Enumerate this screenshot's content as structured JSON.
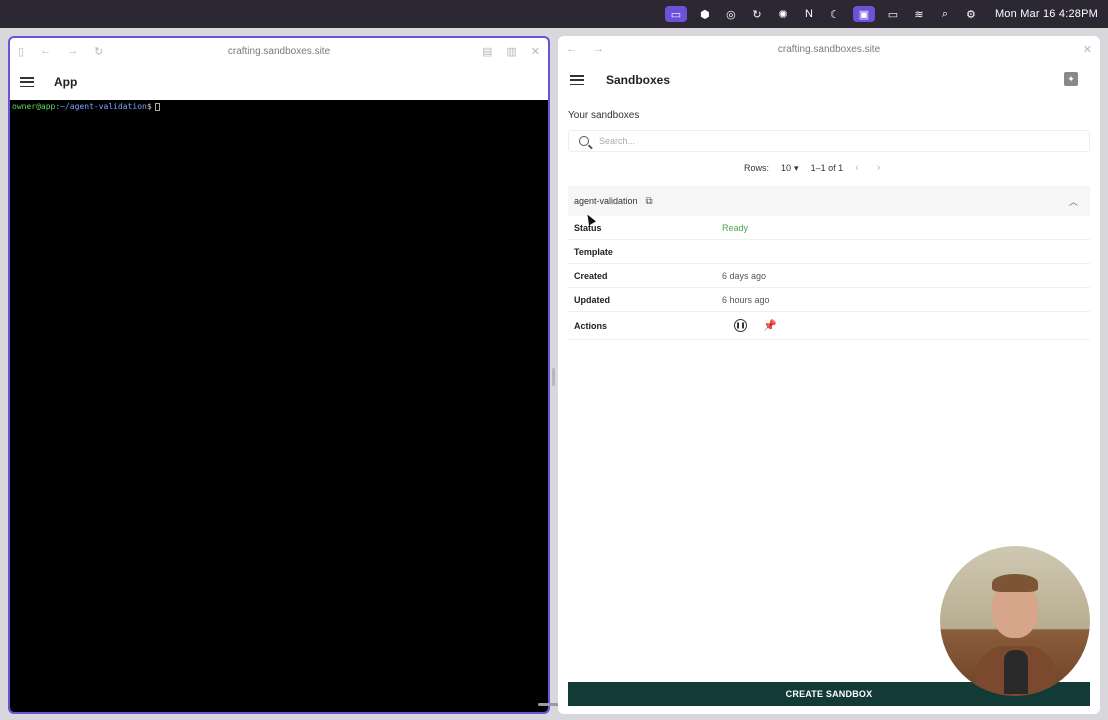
{
  "menubar": {
    "clock": "Mon Mar 16  4:28PM"
  },
  "left_window": {
    "url": "crafting.sandboxes.site",
    "app_title": "App",
    "terminal": {
      "user_host": "owner@app",
      "path": ":~/agent-validation",
      "prompt_symbol": "$"
    }
  },
  "right_window": {
    "url": "crafting.sandboxes.site",
    "app_title": "Sandboxes",
    "section_title": "Your sandboxes",
    "search_placeholder": "Search...",
    "pager": {
      "rows_label": "Rows:",
      "rows_value": "10",
      "range": "1–1 of 1"
    },
    "sandbox": {
      "name": "agent-validation",
      "fields": [
        {
          "label": "Status",
          "value": "Ready"
        },
        {
          "label": "Template",
          "value": ""
        },
        {
          "label": "Created",
          "value": "6 days ago"
        },
        {
          "label": "Updated",
          "value": "6 hours ago"
        }
      ],
      "actions_label": "Actions"
    },
    "create_button": "CREATE SANDBOX"
  },
  "colors": {
    "accent_window_border": "#6b52d9",
    "status_ready": "#4aa44a",
    "create_button_bg": "#123a36"
  }
}
